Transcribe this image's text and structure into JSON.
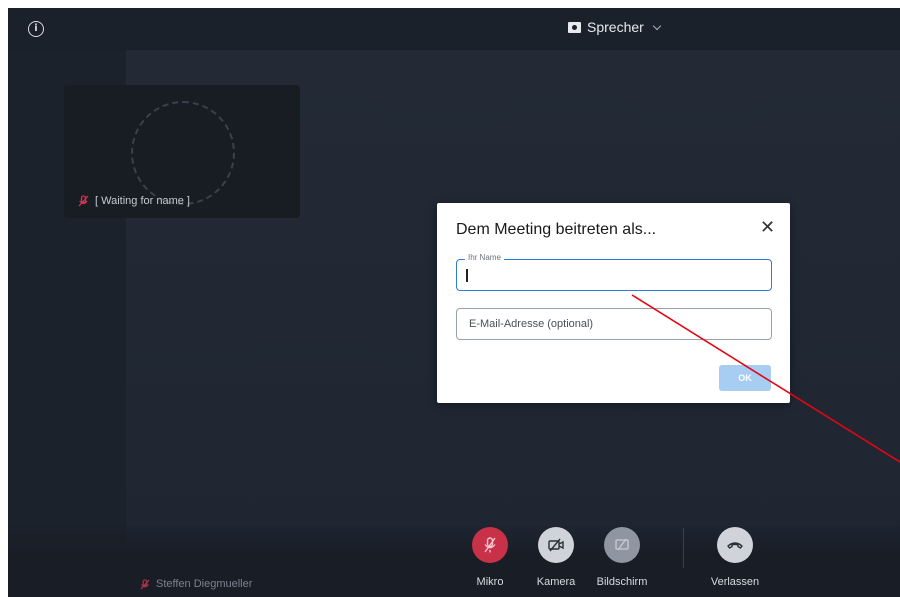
{
  "topbar": {
    "info_icon": "info-icon",
    "layout_label": "Sprecher",
    "layout_icon": "speaker-view-icon"
  },
  "participant_tile": {
    "name": "[ Waiting for name ]",
    "mic_status_icon": "mic-off-icon"
  },
  "self_view": {
    "name": "Steffen Diegmueller",
    "mic_status_icon": "mic-off-icon"
  },
  "controls": [
    {
      "label": "Mikro",
      "icon": "mic-off-icon",
      "color": "#d7374f"
    },
    {
      "label": "Kamera",
      "icon": "camera-off-icon",
      "color": "#d0d4da"
    },
    {
      "label": "Bildschirm",
      "icon": "screenshare-off-icon",
      "color": "#8f96a1"
    },
    {
      "label": "Verlassen",
      "icon": "hangup-icon",
      "color": "#d0d4da"
    }
  ],
  "dialog": {
    "title": "Dem Meeting beitreten als...",
    "name_field_label": "Ihr Name",
    "name_value": "",
    "email_placeholder": "E-Mail-Adresse (optional)",
    "email_value": "",
    "ok_label": "OK",
    "ok_color": "#a7cdf2"
  },
  "annotation": {
    "line_color": "#e30613"
  }
}
